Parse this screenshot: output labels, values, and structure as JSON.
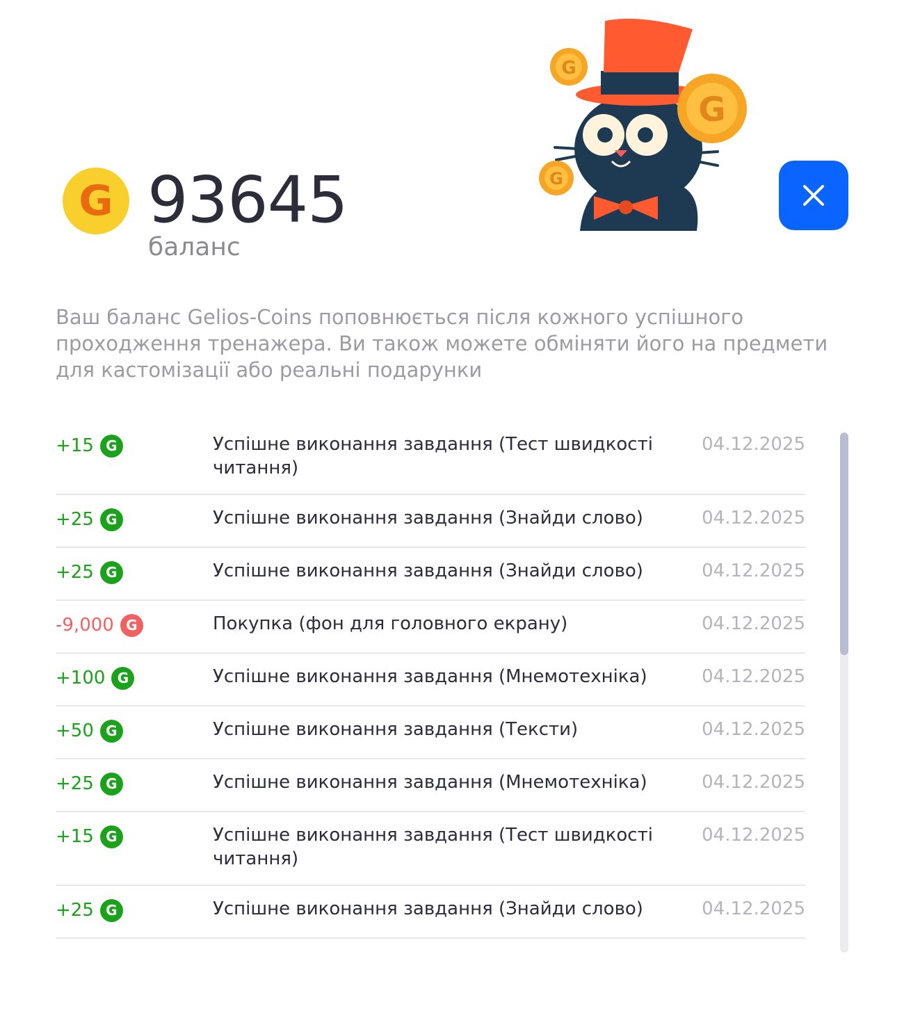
{
  "balance": {
    "coin_letter": "G",
    "value": "93645",
    "label": "баланс"
  },
  "close_button": {
    "icon": "close-icon"
  },
  "mascot": {
    "icon": "cat-with-top-hat-and-coins-illustration",
    "coin_letter": "G"
  },
  "description": "Ваш баланс Gelios-Coins поповнюється після кожного успішного проходження тренажера. Ви також можете обміняти його на предмети для кастомізації або реальні подарунки",
  "colors": {
    "accent": "#0a64ff",
    "positive": "#1aa21a",
    "negative": "#f06262",
    "coin_yellow": "#f9cf2d",
    "coin_orange": "#ea6a10"
  },
  "history": [
    {
      "amount": "+15",
      "type": "pos",
      "coin": "G",
      "description": "Успішне виконання завдання (Тест швидкості читання)",
      "date": "04.12.2025"
    },
    {
      "amount": "+25",
      "type": "pos",
      "coin": "G",
      "description": "Успішне виконання завдання (Знайди слово)",
      "date": "04.12.2025"
    },
    {
      "amount": "+25",
      "type": "pos",
      "coin": "G",
      "description": "Успішне виконання завдання (Знайди слово)",
      "date": "04.12.2025"
    },
    {
      "amount": "-9,000",
      "type": "neg",
      "coin": "G",
      "description": "Покупка (фон для головного екрану)",
      "date": "04.12.2025"
    },
    {
      "amount": "+100",
      "type": "pos",
      "coin": "G",
      "description": "Успішне виконання завдання (Мнемотехніка)",
      "date": "04.12.2025"
    },
    {
      "amount": "+50",
      "type": "pos",
      "coin": "G",
      "description": "Успішне виконання завдання (Тексти)",
      "date": "04.12.2025"
    },
    {
      "amount": "+25",
      "type": "pos",
      "coin": "G",
      "description": "Успішне виконання завдання (Мнемотехніка)",
      "date": "04.12.2025"
    },
    {
      "amount": "+15",
      "type": "pos",
      "coin": "G",
      "description": "Успішне виконання завдання (Тест швидкості читання)",
      "date": "04.12.2025"
    },
    {
      "amount": "+25",
      "type": "pos",
      "coin": "G",
      "description": "Успішне виконання завдання (Знайди слово)",
      "date": "04.12.2025"
    }
  ]
}
